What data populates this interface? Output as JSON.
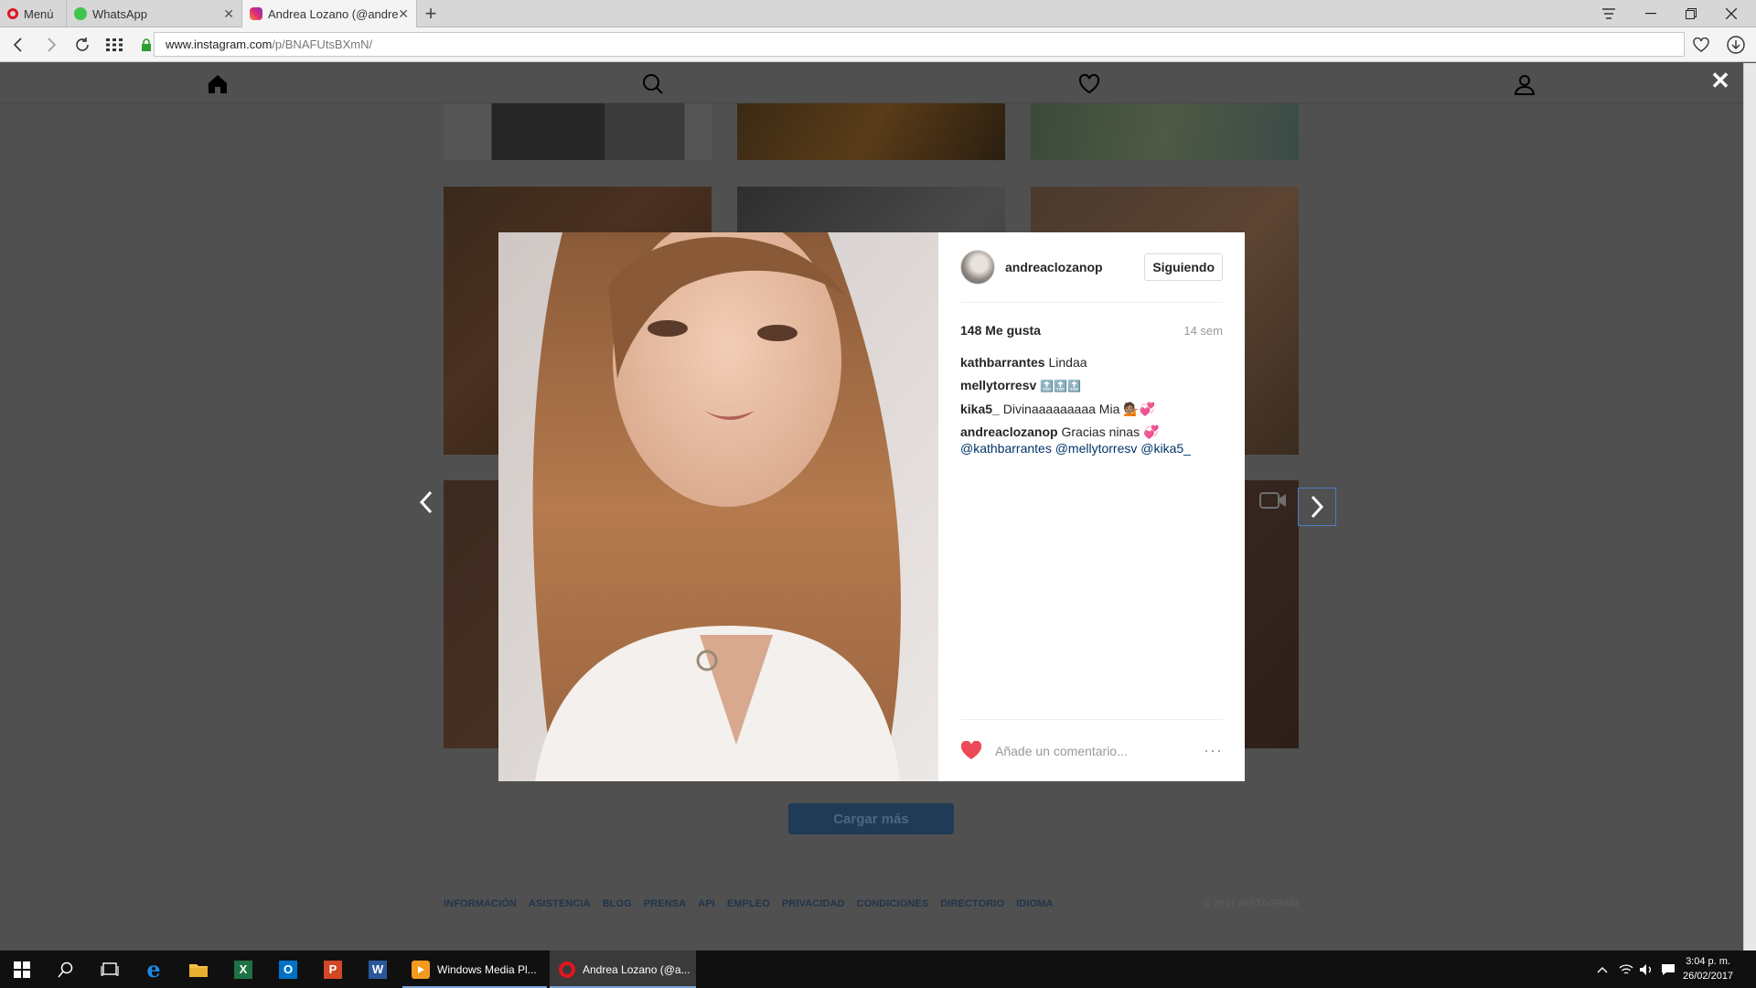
{
  "browser": {
    "menu_label": "Menú",
    "tabs": [
      {
        "title": "WhatsApp",
        "active": false
      },
      {
        "title": "Andrea Lozano (@andreac",
        "active": true
      }
    ],
    "url_host": "www.instagram.com",
    "url_path": "/p/BNAFUtsBXmN/"
  },
  "post": {
    "username": "andreaclozanop",
    "follow_label": "Siguiendo",
    "likes": "148 Me gusta",
    "time": "14 sem",
    "comments": [
      {
        "user": "kathbarrantes",
        "text": "Lindaa"
      },
      {
        "user": "mellytorresv",
        "text": "🔝🔝🔝"
      },
      {
        "user": "kika5_",
        "text": "Divinaaaaaaaaa Mia 💁🏽💞"
      },
      {
        "user": "andreaclozanop",
        "text": "Gracias ninas 💞",
        "mentions": "@kathbarrantes @mellytorresv @kika5_"
      }
    ],
    "comment_placeholder": "Añade un comentario...",
    "more_label": "···"
  },
  "page": {
    "load_more": "Cargar más",
    "footer_links": [
      "INFORMACIÓN",
      "ASISTENCIA",
      "BLOG",
      "PRENSA",
      "API",
      "EMPLEO",
      "PRIVACIDAD",
      "CONDICIONES",
      "DIRECTORIO",
      "IDIOMA"
    ],
    "copyright": "© 2017 INSTAGRAM"
  },
  "taskbar": {
    "apps": [
      {
        "label": "Windows Media Pl..."
      },
      {
        "label": "Andrea Lozano (@a..."
      }
    ],
    "time": "3:04 p. m.",
    "date": "26/02/2017"
  },
  "colors": {
    "accent_blue": "#003569",
    "like_red": "#ed4956",
    "overlay": "#505050"
  }
}
